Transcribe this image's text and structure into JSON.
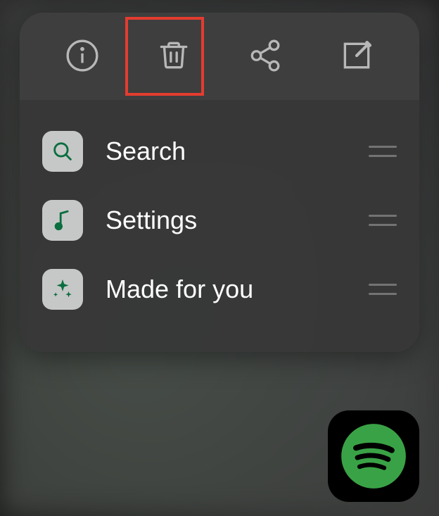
{
  "toolbar": {
    "info": "Info",
    "delete": "Delete",
    "share": "Share",
    "edit": "Edit"
  },
  "shortcuts": [
    {
      "label": "Search",
      "icon": "search"
    },
    {
      "label": "Settings",
      "icon": "music-note"
    },
    {
      "label": "Made for you",
      "icon": "sparkle"
    }
  ],
  "highlighted_action": "delete",
  "app": {
    "name": "Spotify",
    "accent": "#1db954"
  }
}
